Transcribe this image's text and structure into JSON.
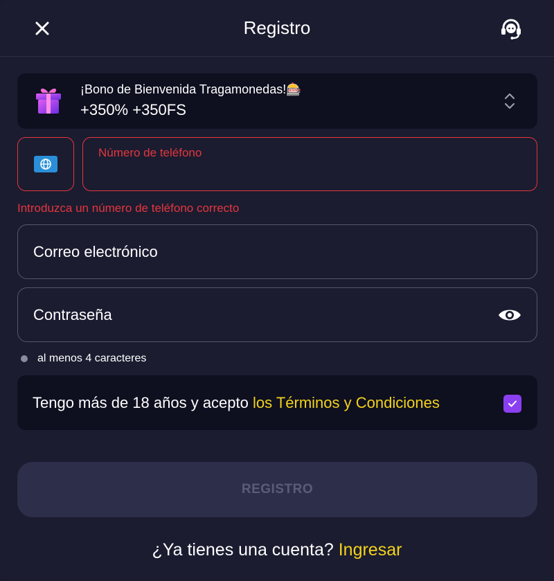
{
  "header": {
    "title": "Registro",
    "close_icon": "close-icon",
    "support_icon": "headset-icon"
  },
  "bonus": {
    "title": "¡Bono de Bienvenida Tragamonedas!🎰",
    "value": "+350% +350FS",
    "icon": "gift-icon",
    "expand_icon": "chevron-updown-icon"
  },
  "phone": {
    "country_icon": "globe-icon",
    "label": "Número de teléfono",
    "error": "Introduzca un número de teléfono correcto"
  },
  "email": {
    "placeholder": "Correo electrónico"
  },
  "password": {
    "placeholder": "Contraseña",
    "toggle_icon": "eye-icon",
    "hint": "al menos 4 caracteres"
  },
  "terms": {
    "text": "Tengo más de 18 años y acepto ",
    "link": "los Términos y Condiciones",
    "checked": true
  },
  "submit": {
    "label": "REGISTRO"
  },
  "footer": {
    "question": "¿Ya tienes una cuenta? ",
    "link": "Ingresar"
  },
  "colors": {
    "background": "#1b1c30",
    "error": "#e5363d",
    "accent_link": "#f3d21b",
    "checkbox": "#8a3ff0"
  }
}
